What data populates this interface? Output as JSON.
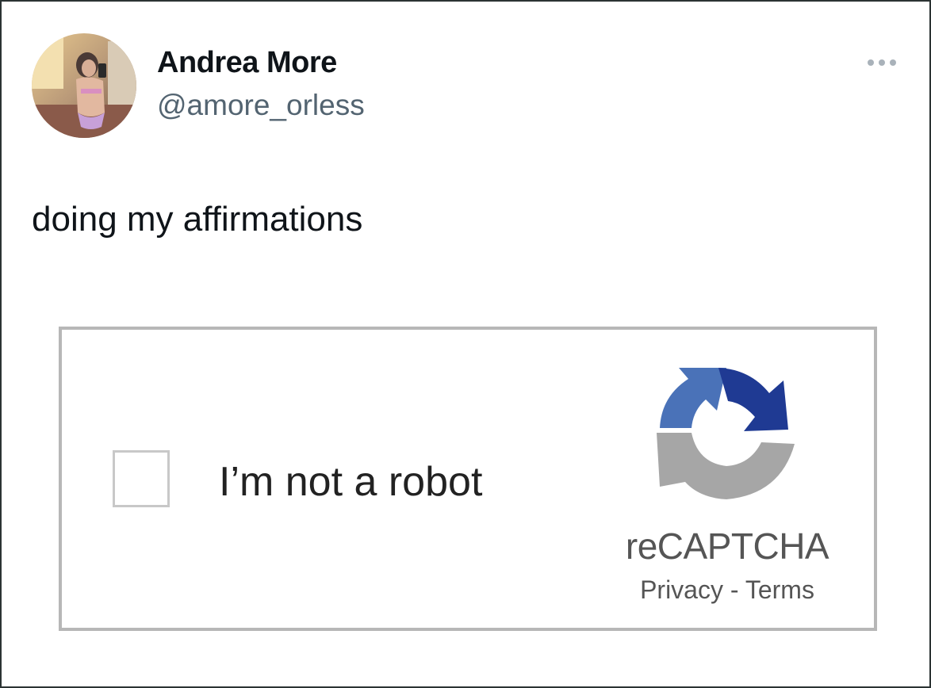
{
  "tweet": {
    "author_name": "Andrea More",
    "author_handle": "@amore_orless",
    "text": "doing my affirmations",
    "more_icon": "more-horizontal-icon"
  },
  "captcha": {
    "checkbox_checked": false,
    "label": "I’m not a robot",
    "brand": "reCAPTCHA",
    "privacy_link": "Privacy",
    "separator": " - ",
    "terms_link": "Terms",
    "logo_icon": "recaptcha-logo-icon",
    "colors": {
      "logo_light_blue": "#4a72b8",
      "logo_dark_blue": "#1f3a93",
      "logo_gray": "#a6a6a6",
      "border": "#b7b7b7"
    }
  }
}
